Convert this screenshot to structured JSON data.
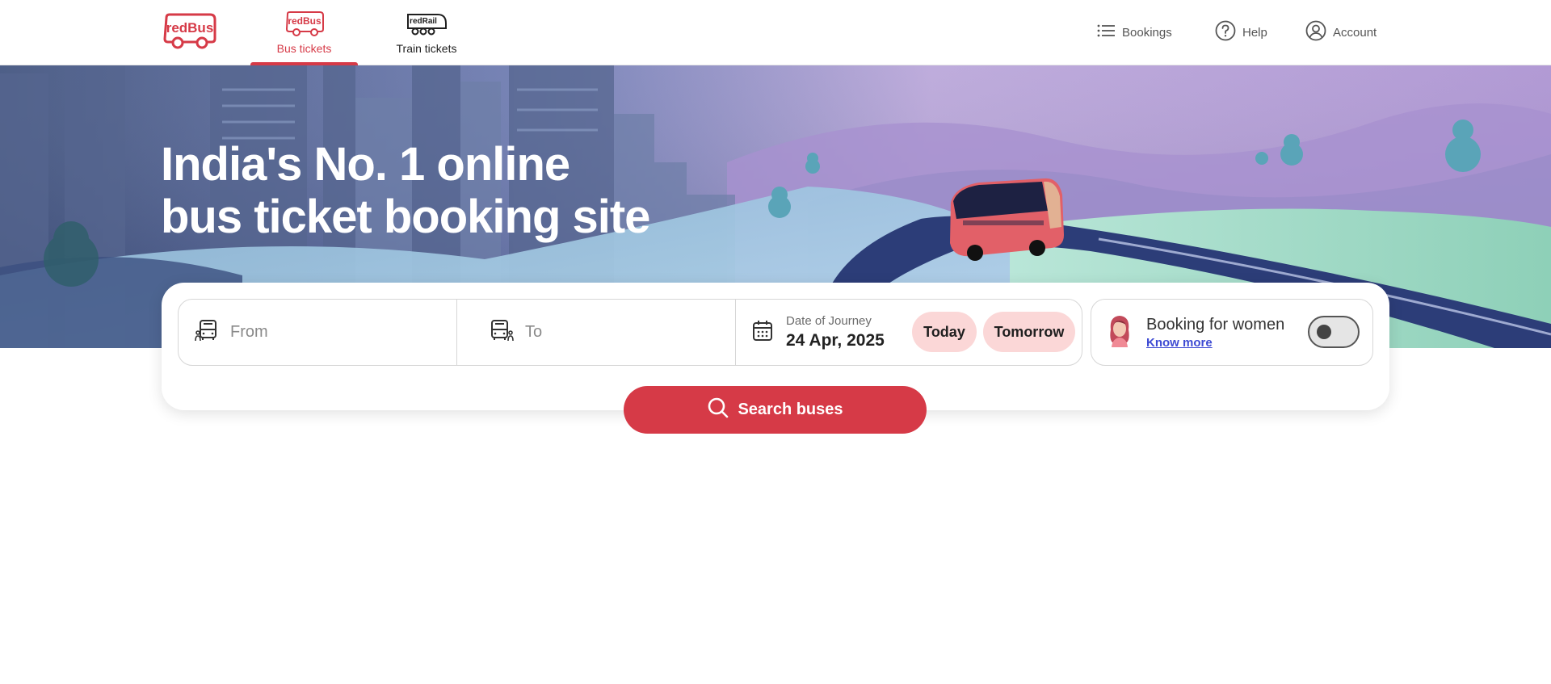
{
  "header": {
    "logo_text": "redBus",
    "tabs": [
      {
        "label": "Bus tickets",
        "icon": "redbus-bus-icon",
        "icon_text": "redBus",
        "active": true
      },
      {
        "label": "Train tickets",
        "icon": "redrail-train-icon",
        "icon_text": "redRail",
        "active": false
      }
    ],
    "links": [
      {
        "label": "Bookings",
        "icon": "list-icon"
      },
      {
        "label": "Help",
        "icon": "help-circle-icon"
      },
      {
        "label": "Account",
        "icon": "account-circle-icon"
      }
    ]
  },
  "hero": {
    "title_line1": "India's No. 1 online",
    "title_line2": "bus ticket booking site"
  },
  "search": {
    "from_placeholder": "From",
    "to_placeholder": "To",
    "date_label": "Date of Journey",
    "date_value": "24 Apr, 2025",
    "chip_today": "Today",
    "chip_tomorrow": "Tomorrow",
    "women_title": "Booking for women",
    "women_link": "Know more",
    "women_toggle_on": false,
    "button_label": "Search buses"
  },
  "colors": {
    "brand_red": "#d63a47",
    "chip_bg": "#fbd7d7",
    "link_blue": "#3e4bd3"
  }
}
